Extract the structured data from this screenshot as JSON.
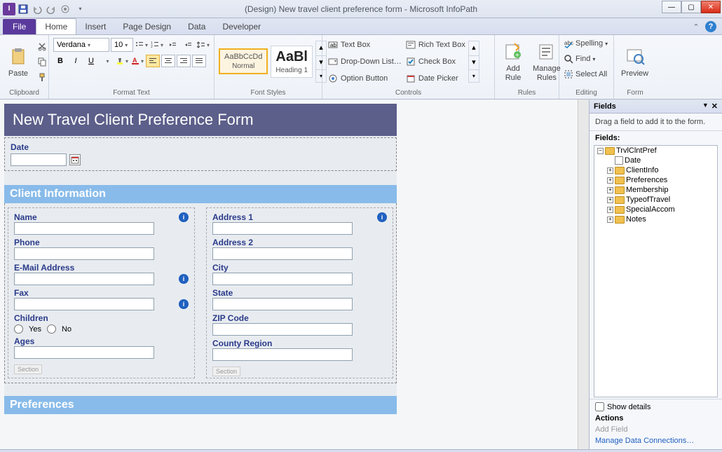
{
  "titlebar": {
    "title": "(Design) New travel client preference form - Microsoft InfoPath"
  },
  "ribbon": {
    "file": "File",
    "tabs": [
      "Home",
      "Insert",
      "Page Design",
      "Data",
      "Developer"
    ],
    "active_tab": "Home",
    "groups": {
      "clipboard": {
        "label": "Clipboard",
        "paste": "Paste"
      },
      "format_text": {
        "label": "Format Text",
        "font_name": "Verdana",
        "font_size": "10"
      },
      "font_styles": {
        "label": "Font Styles",
        "normal_preview": "AaBbCcDd",
        "normal_name": "Normal",
        "heading1_preview": "AaBl",
        "heading1_name": "Heading 1"
      },
      "controls": {
        "label": "Controls",
        "items_left": [
          "Text Box",
          "Drop-Down List…",
          "Option Button"
        ],
        "items_right": [
          "Rich Text Box",
          "Check Box",
          "Date Picker"
        ]
      },
      "rules": {
        "label": "Rules",
        "add_rule": "Add\nRule",
        "manage_rules": "Manage\nRules"
      },
      "editing": {
        "label": "Editing",
        "spelling": "Spelling",
        "find": "Find",
        "select_all": "Select All"
      },
      "form": {
        "label": "Form",
        "preview": "Preview"
      }
    }
  },
  "form": {
    "title": "New Travel Client Preference Form",
    "date_label": "Date",
    "client_info_header": "Client Information",
    "left_fields": {
      "name": "Name",
      "phone": "Phone",
      "email": "E-Mail Address",
      "fax": "Fax",
      "children": "Children",
      "yes": "Yes",
      "no": "No",
      "ages": "Ages"
    },
    "right_fields": {
      "address1": "Address 1",
      "address2": "Address 2",
      "city": "City",
      "state": "State",
      "zip": "ZIP Code",
      "country": "County Region"
    },
    "section_tag": "Section",
    "preferences_header": "Preferences"
  },
  "fields_pane": {
    "title": "Fields",
    "hint": "Drag a field to add it to the form.",
    "subheader": "Fields:",
    "root": "TrvlClntPref",
    "children": [
      "Date",
      "ClientInfo",
      "Preferences",
      "Membership",
      "TypeofTravel",
      "SpecialAccom",
      "Notes"
    ],
    "show_details": "Show details",
    "actions_header": "Actions",
    "add_field": "Add Field",
    "manage_conn": "Manage Data Connections…"
  }
}
